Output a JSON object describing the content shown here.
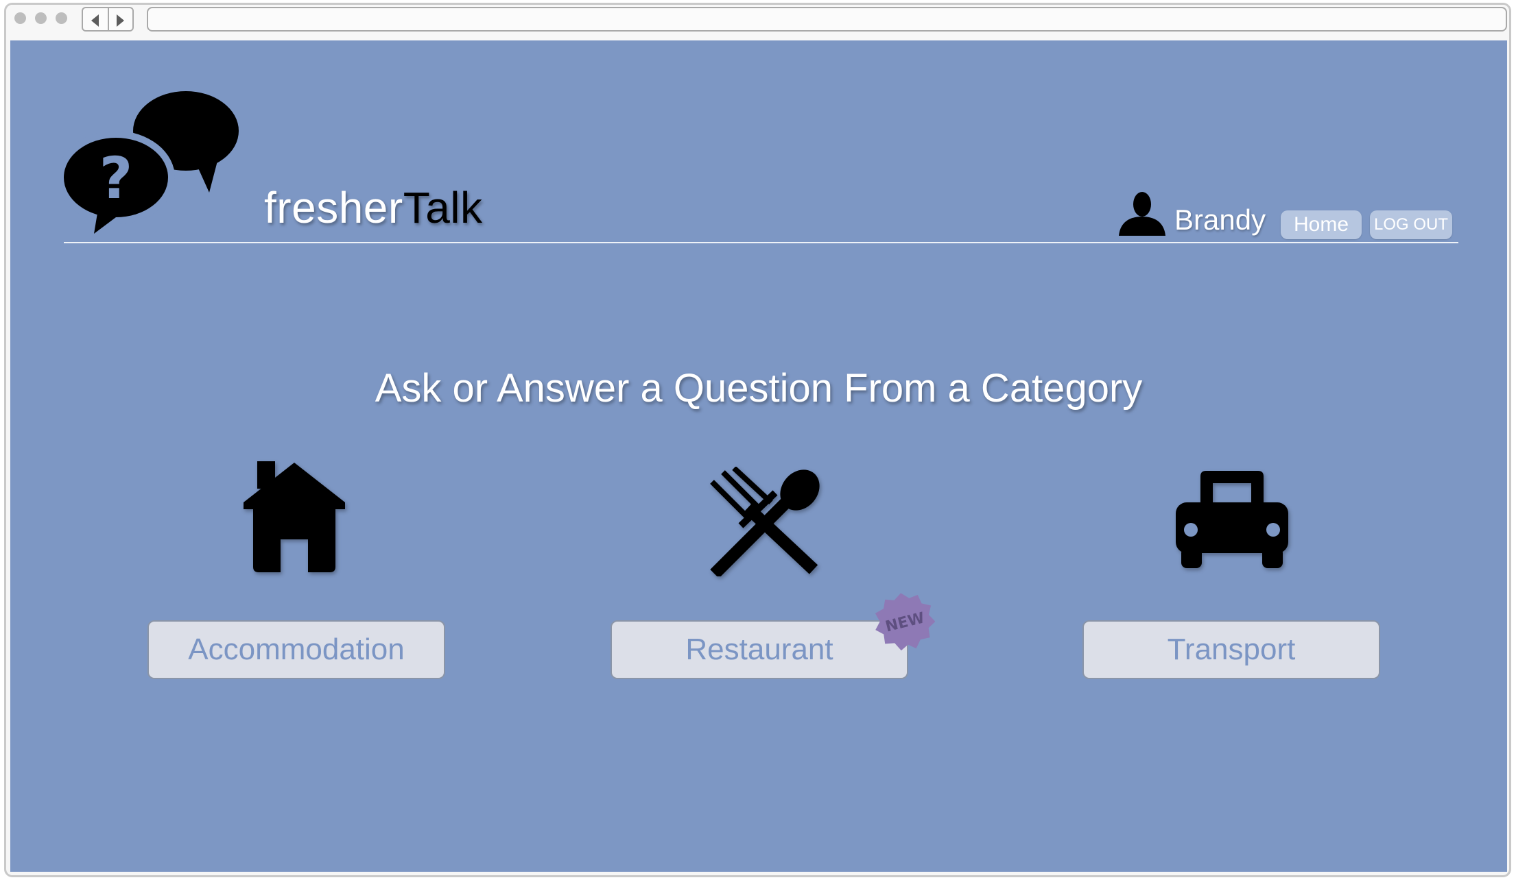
{
  "browser": {
    "back_icon": "chevron-left-icon",
    "forward_icon": "chevron-right-icon",
    "url": ""
  },
  "header": {
    "logo_icon": "chat-bubbles-question-icon",
    "brand_part1": "fresher",
    "brand_part2": "Talk",
    "user_icon": "user-silhouette-icon",
    "username": "Brandy",
    "home_label": "Home",
    "logout_label": "LOG OUT"
  },
  "main": {
    "heading": "Ask or Answer a Question From a Category",
    "categories": [
      {
        "label": "Accommodation",
        "icon": "house-icon",
        "badge": ""
      },
      {
        "label": "Restaurant",
        "icon": "fork-spoon-icon",
        "badge": "NEW"
      },
      {
        "label": "Transport",
        "icon": "car-icon",
        "badge": ""
      }
    ]
  },
  "colors": {
    "page_background": "#7d97c4",
    "button_background": "#dcdfe8",
    "button_text": "#7b95c4",
    "pill_background": "#b6c6e0",
    "badge_color": "#8e79b5"
  }
}
